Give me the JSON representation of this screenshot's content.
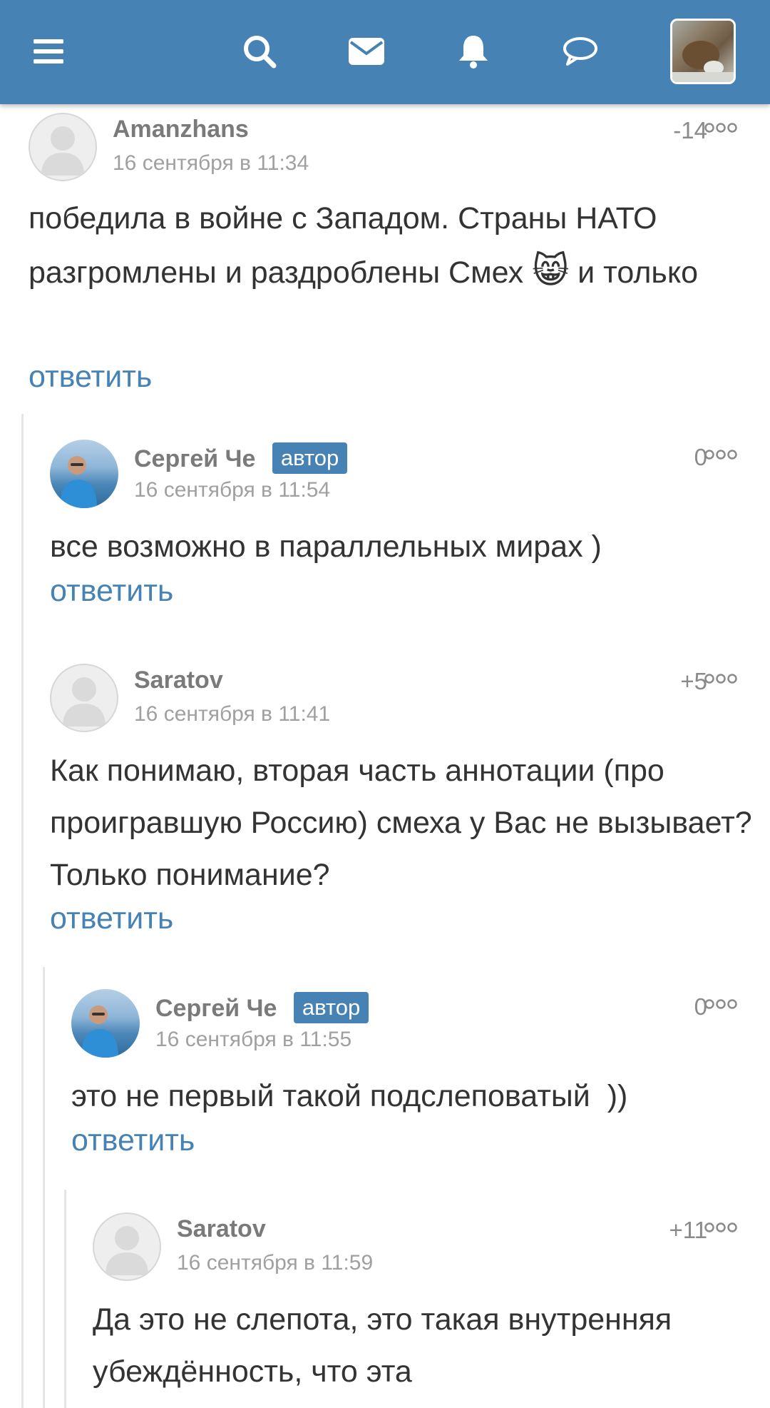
{
  "header": {
    "icons": [
      "menu-icon",
      "search-icon",
      "mail-icon",
      "bell-icon",
      "chat-icon",
      "user-avatar"
    ],
    "color": "#4682b4"
  },
  "reply_label": "ответить",
  "author_badge": "автор",
  "comments": [
    {
      "author": "Amanzhans",
      "date": "16 сентября в 11:34",
      "score": "-14",
      "text_parts": [
        "победила в войне с Западом. Страны НАТО разгромлены и раздроблены Смех",
        "и только"
      ],
      "emoji": "😸"
    },
    {
      "author": "Сергей Че",
      "date": "16 сентября в 11:54",
      "score": "0",
      "text": "все возможно в параллельных мирах )"
    },
    {
      "author": "Saratov",
      "date": "16 сентября в 11:41",
      "score": "+5",
      "text": "Как понимаю, вторая часть аннотации (про проигравшую Россию) смеха у Вас не вызывает? Только понимание?"
    },
    {
      "author": "Сергей Че",
      "date": "16 сентября в 11:55",
      "score": "0",
      "text": "это не первый такой подслеповатый  ))"
    },
    {
      "author": "Saratov",
      "date": "16 сентября в 11:59",
      "score": "+11",
      "text": "Да это не слепота, это такая внутренняя убеждённость, что эта"
    }
  ]
}
